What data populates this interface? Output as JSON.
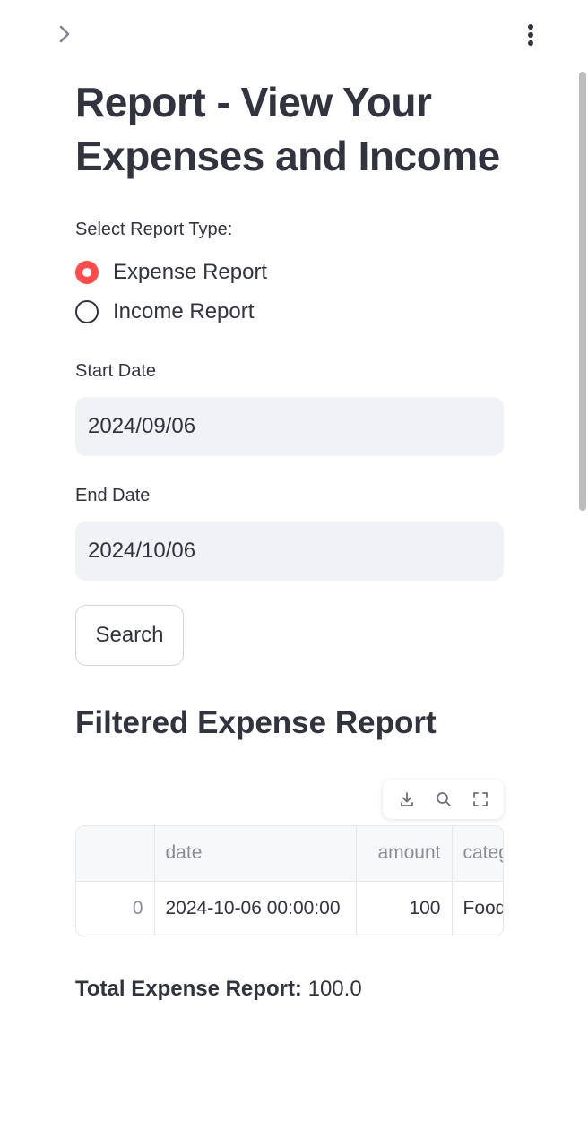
{
  "page": {
    "title": "Report - View Your Expenses and Income"
  },
  "report_type": {
    "label": "Select Report Type:",
    "options": [
      {
        "label": "Expense Report",
        "selected": true
      },
      {
        "label": "Income Report",
        "selected": false
      }
    ]
  },
  "start_date": {
    "label": "Start Date",
    "value": "2024/09/06"
  },
  "end_date": {
    "label": "End Date",
    "value": "2024/10/06"
  },
  "search_button": {
    "label": "Search"
  },
  "results": {
    "title": "Filtered Expense Report",
    "columns": [
      "",
      "date",
      "amount",
      "category"
    ],
    "rows": [
      {
        "index": "0",
        "date": "2024-10-06 00:00:00",
        "amount": "100",
        "category": "Food"
      }
    ]
  },
  "total": {
    "label": "Total Expense Report:",
    "value": "100.0"
  },
  "icons": {
    "sidebar_toggle": "chevron-right-icon",
    "menu": "more-vertical-icon",
    "download": "download-icon",
    "search": "search-icon",
    "fullscreen": "fullscreen-icon"
  },
  "colors": {
    "accent": "#ff4b4b",
    "text": "#31333f",
    "input_bg": "#f0f2f6"
  }
}
